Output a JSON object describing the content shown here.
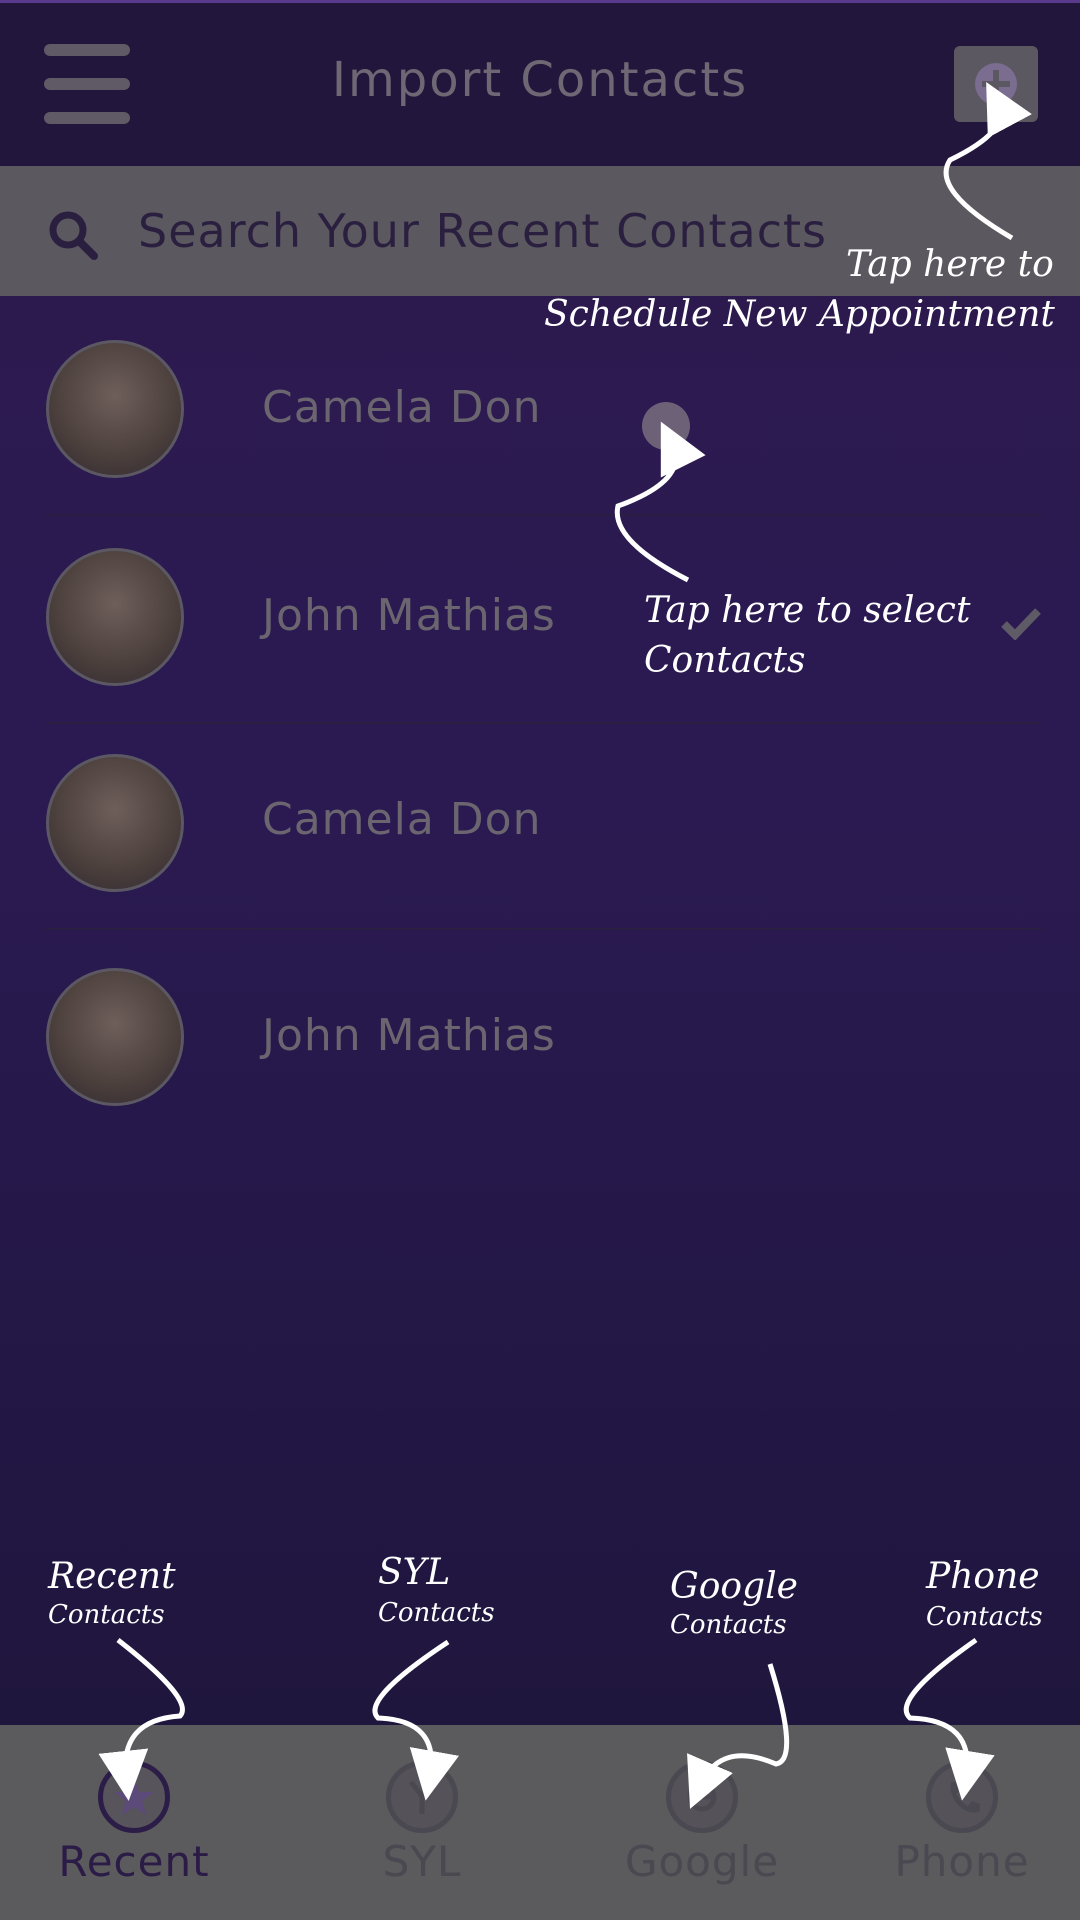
{
  "header": {
    "title": "Import Contacts",
    "menu_icon": "hamburger-menu-icon",
    "add_icon": "plus-circle-icon"
  },
  "search": {
    "placeholder": "Search Your Recent Contacts",
    "icon": "search-icon"
  },
  "contacts": [
    {
      "name": "Camela Don",
      "selected": false
    },
    {
      "name": "John Mathias",
      "selected": true
    },
    {
      "name": "Camela Don",
      "selected": false
    },
    {
      "name": "John Mathias",
      "selected": false
    }
  ],
  "annotations": {
    "add_line1": "Tap here to",
    "add_line2": "Schedule New Appointment",
    "select_line1": "Tap here to select",
    "select_line2": "Contacts",
    "recent_title": "Recent",
    "recent_sub": "Contacts",
    "syl_title": "SYL",
    "syl_sub": "Contacts",
    "google_title": "Google",
    "google_sub": "Contacts",
    "phone_title": "Phone",
    "phone_sub": "Contacts"
  },
  "nav": {
    "active": "Recent",
    "items": [
      {
        "label": "Recent",
        "icon": "star-icon"
      },
      {
        "label": "SYL",
        "icon": "syl-logo-icon"
      },
      {
        "label": "Google",
        "icon": "google-icon"
      },
      {
        "label": "Phone",
        "icon": "phone-icon"
      }
    ]
  },
  "colors": {
    "accent": "#2c1d48",
    "topbar": "#23163c",
    "searchbar": "#5b5860",
    "nav": "#5b5a5c"
  }
}
